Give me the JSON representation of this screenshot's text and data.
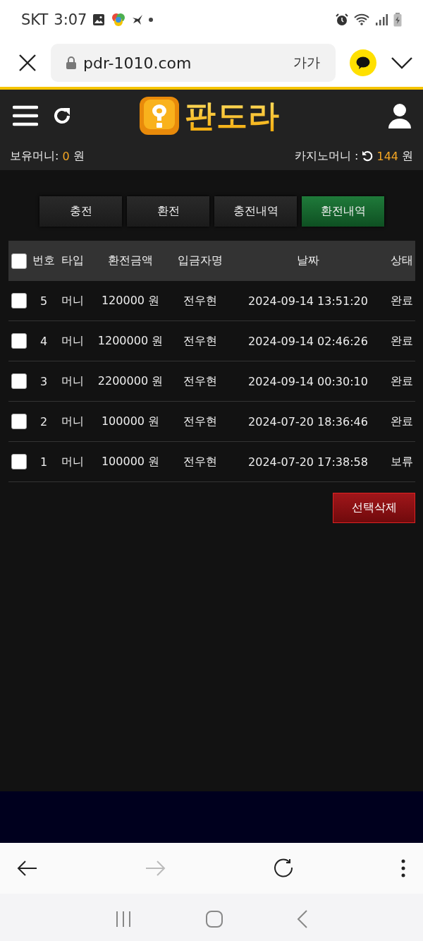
{
  "status_bar": {
    "carrier": "SKT",
    "time": "3:07"
  },
  "browser": {
    "url": "pdr-1010.com",
    "text_size": "가가"
  },
  "header": {
    "logo_text": "판도라"
  },
  "balances": {
    "held_label": "보유머니:",
    "held_value": "0",
    "held_unit": "원",
    "casino_label": "카지노머니 :",
    "casino_value": "144",
    "casino_unit": "원"
  },
  "tabs": [
    {
      "label": "충전",
      "selected": false
    },
    {
      "label": "환전",
      "selected": false
    },
    {
      "label": "충전내역",
      "selected": false
    },
    {
      "label": "환전내역",
      "selected": true
    }
  ],
  "table": {
    "select_all_checked": false,
    "columns": [
      "번호",
      "타입",
      "환전금액",
      "입금자명",
      "날짜",
      "상태"
    ],
    "rows": [
      {
        "checked": false,
        "cells": [
          "5",
          "머니",
          "120000 원",
          "전우현",
          "2024-09-14 13:51:20",
          "완료"
        ]
      },
      {
        "checked": false,
        "cells": [
          "4",
          "머니",
          "1200000 원",
          "전우현",
          "2024-09-14 02:46:26",
          "완료"
        ]
      },
      {
        "checked": false,
        "cells": [
          "3",
          "머니",
          "2200000 원",
          "전우현",
          "2024-09-14 00:30:10",
          "완료"
        ]
      },
      {
        "checked": false,
        "cells": [
          "2",
          "머니",
          "100000 원",
          "전우현",
          "2024-07-20 18:36:46",
          "완료"
        ]
      },
      {
        "checked": false,
        "cells": [
          "1",
          "머니",
          "100000 원",
          "전우현",
          "2024-07-20 17:38:58",
          "보류"
        ]
      }
    ]
  },
  "delete_button": "선택삭제"
}
